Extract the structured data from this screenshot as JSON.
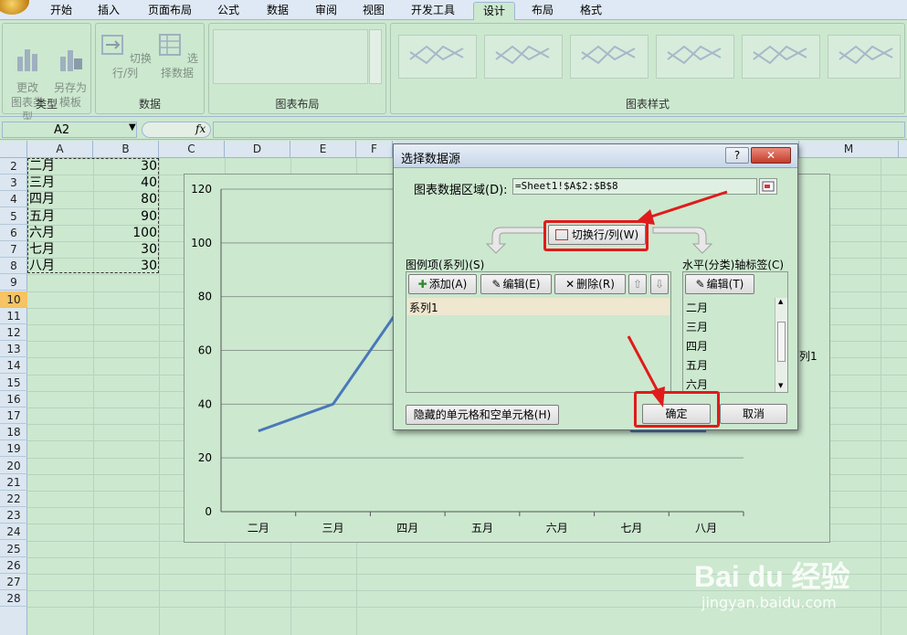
{
  "ribbon": {
    "tabs": [
      "开始",
      "插入",
      "页面布局",
      "公式",
      "数据",
      "审阅",
      "视图",
      "开发工具",
      "设计",
      "布局",
      "格式"
    ],
    "active_tab": "设计",
    "groups": {
      "type": {
        "label": "类型",
        "change_type": "更改\n图表类型",
        "save_template": "另存为\n模板"
      },
      "data": {
        "label": "数据",
        "switch": "切换行/列",
        "select_data": "选择数据"
      },
      "layout": {
        "label": "图表布局"
      },
      "styles": {
        "label": "图表样式"
      }
    }
  },
  "formula_bar": {
    "name_box": "A2",
    "fx": "fx"
  },
  "sheet": {
    "columns": [
      "A",
      "B",
      "C",
      "D",
      "E",
      "F",
      "M"
    ],
    "rows": [
      "2",
      "3",
      "4",
      "5",
      "6",
      "7",
      "8",
      "9",
      "10",
      "11",
      "12",
      "13",
      "14",
      "15",
      "16",
      "17",
      "18",
      "19",
      "20",
      "21",
      "22",
      "23",
      "24",
      "25",
      "26",
      "27",
      "28"
    ],
    "selected_row": "10",
    "cells_a": [
      "二月",
      "三月",
      "四月",
      "五月",
      "六月",
      "七月",
      "八月"
    ],
    "cells_b": [
      "30",
      "40",
      "80",
      "90",
      "100",
      "30",
      "30"
    ]
  },
  "chart_data": {
    "type": "line",
    "categories": [
      "二月",
      "三月",
      "四月",
      "五月",
      "六月",
      "七月",
      "八月"
    ],
    "series": [
      {
        "name": "系列1",
        "values": [
          30,
          40,
          80,
          90,
          100,
          30,
          30
        ],
        "color": "#4a78b8"
      }
    ],
    "ylim": [
      0,
      120
    ],
    "yticks": [
      "0",
      "20",
      "40",
      "60",
      "80",
      "100",
      "120"
    ],
    "legend_visible_text": "列1",
    "grid": true
  },
  "dialog": {
    "title": "选择数据源",
    "help": "?",
    "close": "✕",
    "range_label": "图表数据区域(D):",
    "range_value": "=Sheet1!$A$2:$B$8",
    "switch_button": "切换行/列(W)",
    "legend_label": "图例项(系列)(S)",
    "axis_label": "水平(分类)轴标签(C)",
    "add": "添加(A)",
    "edit": "编辑(E)",
    "delete": "删除(R)",
    "edit_axis": "编辑(T)",
    "series_items": [
      "系列1"
    ],
    "axis_items": [
      "二月",
      "三月",
      "四月",
      "五月",
      "六月"
    ],
    "hidden_cells": "隐藏的单元格和空单元格(H)",
    "ok": "确定",
    "cancel": "取消"
  },
  "watermark": {
    "brand": "Bai du 经验",
    "url": "jingyan.baidu.com"
  }
}
